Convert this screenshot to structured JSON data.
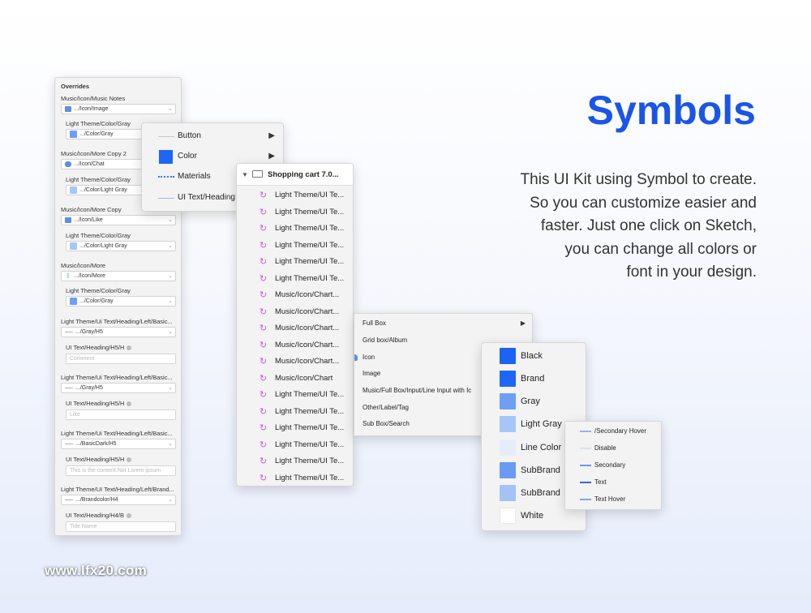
{
  "hero": {
    "title": "Symbols",
    "description_lines": [
      "This UI Kit using Symbol to create.",
      "So you can customize easier and",
      "faster. Just one click on Sketch,",
      "you can change all colors or",
      "font in your design."
    ]
  },
  "watermark": "www.lfx20.com",
  "colors": {
    "accent": "#1a55e8",
    "black": "#1a63f5",
    "brand": "#1f66f6",
    "gray": "#6f9ef5",
    "light_gray": "#a7c6f8",
    "line_color": "#e6edfa",
    "subbrand_1": "#6b9af2",
    "subbrand_2": "#a3c2f6",
    "white": "#ffffff",
    "symbol_icon": "#c45ee0"
  },
  "overrides": {
    "header": "Overrides",
    "groups": [
      {
        "label": "Music/Icon/Music Notes",
        "value": ".../Icon/Image",
        "icon": "image-icon"
      },
      {
        "label": "Light Theme/Color/Gray",
        "value": ".../Color/Gray"
      },
      {
        "label": "Music/Icon/More Copy 2",
        "value": ".../Icon/Chat",
        "icon": "chat-icon"
      },
      {
        "label": "Light Theme/Color/Gray",
        "value": ".../Color/Light Gray"
      },
      {
        "label": "Music/Icon/More Copy",
        "value": ".../Icon/Like",
        "icon": "like-icon"
      },
      {
        "label": "Light Theme/Color/Gray",
        "value": ".../Color/Light Gray"
      },
      {
        "label": "Music/Icon/More",
        "value": ".../Icon/More",
        "icon": "more-icon"
      },
      {
        "label": "Light Theme/Color/Gray",
        "value": ".../Color/Gray"
      },
      {
        "label": "Light Theme/Ui Text/Heading/Left/Basic...",
        "value": ".../Gray/H5"
      },
      {
        "label": "UI Text/Heading/H5/H",
        "placeholder": "Comment"
      },
      {
        "label": "Light Theme/Ui Text/Heading/Left/Basic...",
        "value": ".../Gray/H5"
      },
      {
        "label": "UI Text/Heading/H5/H",
        "placeholder": "Like"
      },
      {
        "label": "Light Theme/Ui Text/Heading/Left/Basic...",
        "value": ".../BasicDark/H5"
      },
      {
        "label": "UI Text/Heading/H5/H",
        "placeholder": "This is the content.Not Lorem ipsum"
      },
      {
        "label": "Light Theme/UI Text/Heading/Left/Brand...",
        "value": ".../Brandcolor/H4"
      },
      {
        "label": "UI Text/Heading/H4/B",
        "placeholder": "Title Name"
      }
    ]
  },
  "type_menu": {
    "items": [
      {
        "label": "Button",
        "has_submenu": true
      },
      {
        "label": "Color",
        "has_submenu": true
      },
      {
        "label": "Materials",
        "has_submenu": false
      },
      {
        "label": "UI Text/Heading",
        "has_submenu": false
      }
    ]
  },
  "shopping_cart": {
    "header": "Shopping cart 7.0...",
    "items": [
      "Light Theme/UI Te...",
      "Light Theme/UI Te...",
      "Light Theme/UI Te...",
      "Light Theme/UI Te...",
      "Light Theme/UI Te...",
      "Light Theme/UI Te...",
      "Music/Icon/Chart...",
      "Music/Icon/Chart...",
      "Music/Icon/Chart...",
      "Music/Icon/Chart...",
      "Music/Icon/Chart...",
      "Music/Icon/Chart",
      "Light Theme/UI Te...",
      "Light Theme/UI Te...",
      "Light Theme/UI Te...",
      "Light Theme/UI Te...",
      "Light Theme/UI Te...",
      "Light Theme/UI Te..."
    ]
  },
  "fullbox_menu": {
    "items": [
      {
        "label": "Full Box",
        "has_submenu": true
      },
      {
        "label": "Grid box/Album"
      },
      {
        "label": "Icon"
      },
      {
        "label": "Image"
      },
      {
        "label": "Music/Full Box/Input/Line Input with Ic"
      },
      {
        "label": "Other/Label/Tag"
      },
      {
        "label": "Sub Box/Search"
      }
    ]
  },
  "color_menu": {
    "items": [
      {
        "label": "Black",
        "color": "#1a63f5"
      },
      {
        "label": "Brand",
        "color": "#1f66f6"
      },
      {
        "label": "Gray",
        "color": "#6f9ef5"
      },
      {
        "label": "Light Gray",
        "color": "#a7c6f8"
      },
      {
        "label": "Line Color",
        "color": "#e6edfa"
      },
      {
        "label": "SubBrand",
        "color": "#6b9af2"
      },
      {
        "label": "SubBrand",
        "color": "#a3c2f6"
      },
      {
        "label": "White",
        "color": "#ffffff"
      }
    ]
  },
  "state_menu": {
    "items": [
      {
        "label": "/Secondary Hover",
        "color": "#8fb2f3"
      },
      {
        "label": "Disable",
        "color": "#dbe3f3"
      },
      {
        "label": "Secondary",
        "color": "#6e98ec"
      },
      {
        "label": "Text",
        "color": "#2f67e6"
      },
      {
        "label": "Text Hover",
        "color": "#7ea5ef"
      }
    ]
  }
}
